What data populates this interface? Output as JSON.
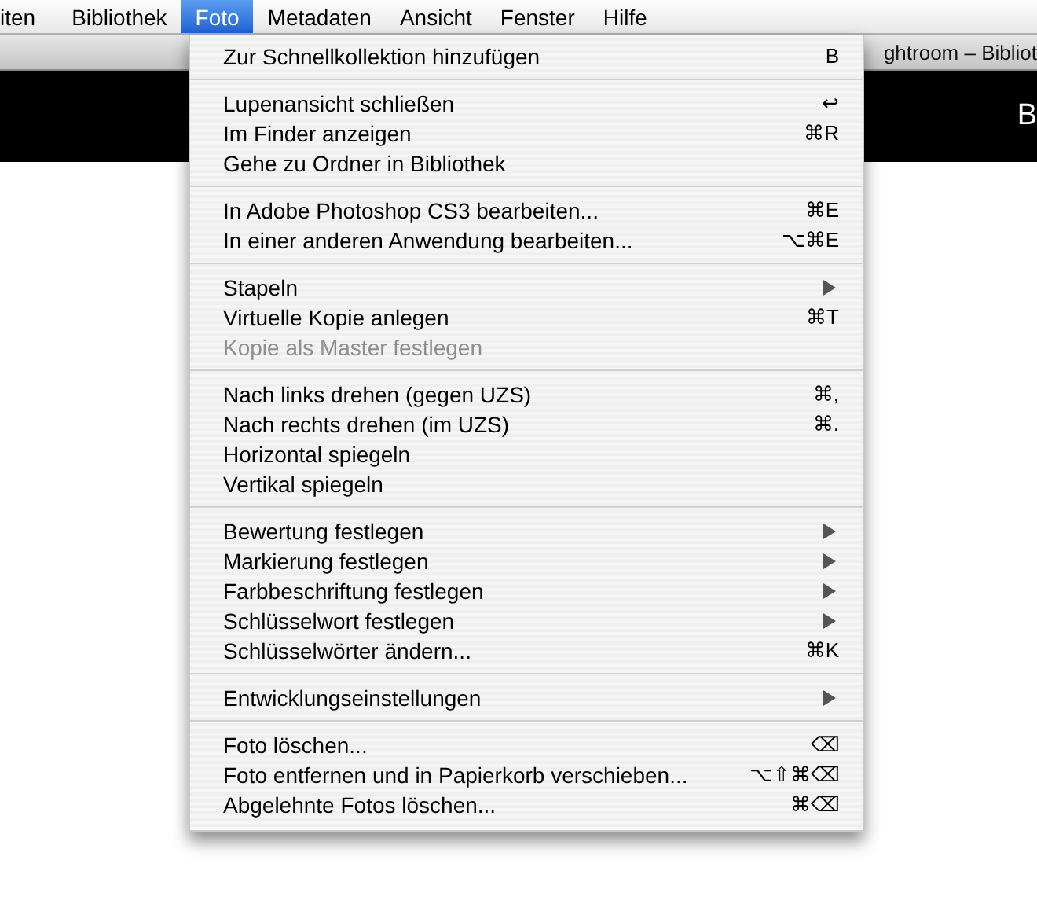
{
  "menubar": [
    {
      "label": "iten",
      "selected": false
    },
    {
      "label": "Bibliothek",
      "selected": false
    },
    {
      "label": "Foto",
      "selected": true
    },
    {
      "label": "Metadaten",
      "selected": false
    },
    {
      "label": "Ansicht",
      "selected": false
    },
    {
      "label": "Fenster",
      "selected": false
    },
    {
      "label": "Hilfe",
      "selected": false
    }
  ],
  "window": {
    "title": "ghtroom – Bibliot",
    "header_text": "B"
  },
  "menu": {
    "groups": [
      [
        {
          "label": "Zur Schnellkollektion hinzufügen",
          "shortcut": "B",
          "submenu": false,
          "disabled": false
        }
      ],
      [
        {
          "label": "Lupenansicht schließen",
          "shortcut": "↩",
          "submenu": false,
          "disabled": false
        },
        {
          "label": "Im Finder anzeigen",
          "shortcut": "⌘R",
          "submenu": false,
          "disabled": false
        },
        {
          "label": "Gehe zu Ordner in Bibliothek",
          "submenu": false,
          "disabled": false
        }
      ],
      [
        {
          "label": "In Adobe Photoshop CS3 bearbeiten...",
          "shortcut": "⌘E",
          "submenu": false,
          "disabled": false
        },
        {
          "label": "In einer anderen Anwendung bearbeiten...",
          "shortcut": "⌥⌘E",
          "submenu": false,
          "disabled": false
        }
      ],
      [
        {
          "label": "Stapeln",
          "submenu": true,
          "disabled": false
        },
        {
          "label": "Virtuelle Kopie anlegen",
          "shortcut": "⌘T",
          "submenu": false,
          "disabled": false
        },
        {
          "label": "Kopie als Master festlegen",
          "submenu": false,
          "disabled": true
        }
      ],
      [
        {
          "label": "Nach links drehen (gegen UZS)",
          "shortcut": "⌘,",
          "submenu": false,
          "disabled": false
        },
        {
          "label": "Nach rechts drehen (im UZS)",
          "shortcut": "⌘.",
          "submenu": false,
          "disabled": false
        },
        {
          "label": "Horizontal spiegeln",
          "submenu": false,
          "disabled": false
        },
        {
          "label": "Vertikal spiegeln",
          "submenu": false,
          "disabled": false
        }
      ],
      [
        {
          "label": "Bewertung festlegen",
          "submenu": true,
          "disabled": false
        },
        {
          "label": "Markierung festlegen",
          "submenu": true,
          "disabled": false
        },
        {
          "label": "Farbbeschriftung festlegen",
          "submenu": true,
          "disabled": false
        },
        {
          "label": "Schlüsselwort festlegen",
          "submenu": true,
          "disabled": false
        },
        {
          "label": "Schlüsselwörter ändern...",
          "shortcut": "⌘K",
          "submenu": false,
          "disabled": false
        }
      ],
      [
        {
          "label": "Entwicklungseinstellungen",
          "submenu": true,
          "disabled": false
        }
      ],
      [
        {
          "label": "Foto löschen...",
          "shortcut": "⌫",
          "submenu": false,
          "disabled": false
        },
        {
          "label": "Foto entfernen und in Papierkorb verschieben...",
          "shortcut": "⌥⇧⌘⌫",
          "submenu": false,
          "disabled": false
        },
        {
          "label": "Abgelehnte Fotos löschen...",
          "shortcut": "⌘⌫",
          "submenu": false,
          "disabled": false
        }
      ]
    ]
  }
}
